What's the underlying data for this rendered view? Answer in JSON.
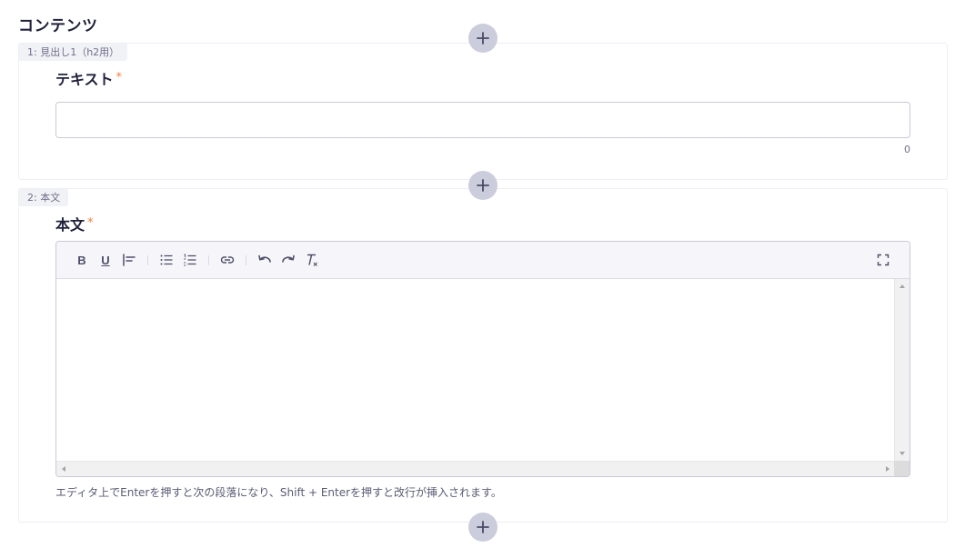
{
  "section": {
    "title": "コンテンツ"
  },
  "blocks": [
    {
      "tag": "1: 見出し1（h2用）",
      "field_label": "テキスト",
      "required_mark": "*",
      "input_value": "",
      "char_count": "0"
    },
    {
      "tag": "2: 本文",
      "field_label": "本文",
      "required_mark": "*",
      "toolbar": {
        "bold": "B",
        "underline": "U",
        "icons": [
          "align-icon",
          "bullet-list-icon",
          "numbered-list-icon",
          "link-icon",
          "undo-icon",
          "redo-icon",
          "clear-format-icon",
          "fullscreen-icon"
        ]
      },
      "help_text": "エディタ上でEnterを押すと次の段落になり、Shift + Enterを押すと改行が挿入されます。"
    }
  ],
  "colors": {
    "add_button": "#cccddc",
    "required": "#f4803c",
    "text": "#21213b"
  }
}
